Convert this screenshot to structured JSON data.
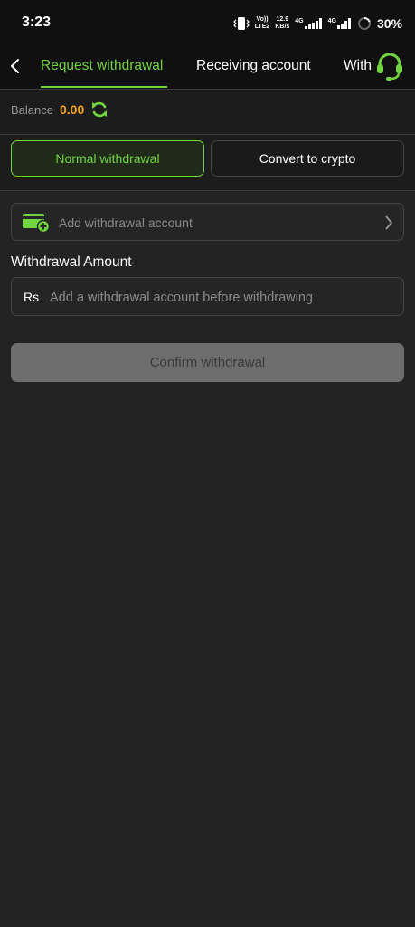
{
  "status_bar": {
    "time": "3:23",
    "volte": "Vo))",
    "lte": "LTE2",
    "net_speed_value": "12.9",
    "net_speed_unit": "KB/s",
    "sim1_tech": "4G",
    "sim2_tech": "4G",
    "battery_percent": "30%"
  },
  "nav": {
    "tabs": [
      {
        "label": "Request withdrawal",
        "active": true
      },
      {
        "label": "Receiving account",
        "active": false
      },
      {
        "label": "Withdrawal record",
        "active": false
      }
    ]
  },
  "balance": {
    "label": "Balance",
    "value": "0.00"
  },
  "modes": {
    "normal_label": "Normal withdrawal",
    "crypto_label": "Convert to crypto"
  },
  "account": {
    "add_label": "Add withdrawal account"
  },
  "amount": {
    "label": "Withdrawal Amount",
    "currency": "Rs",
    "placeholder": "Add a withdrawal account before withdrawing",
    "value": ""
  },
  "confirm_label": "Confirm withdrawal",
  "colors": {
    "accent": "#72d43f",
    "balance": "#f4a51c",
    "background": "#232323"
  }
}
